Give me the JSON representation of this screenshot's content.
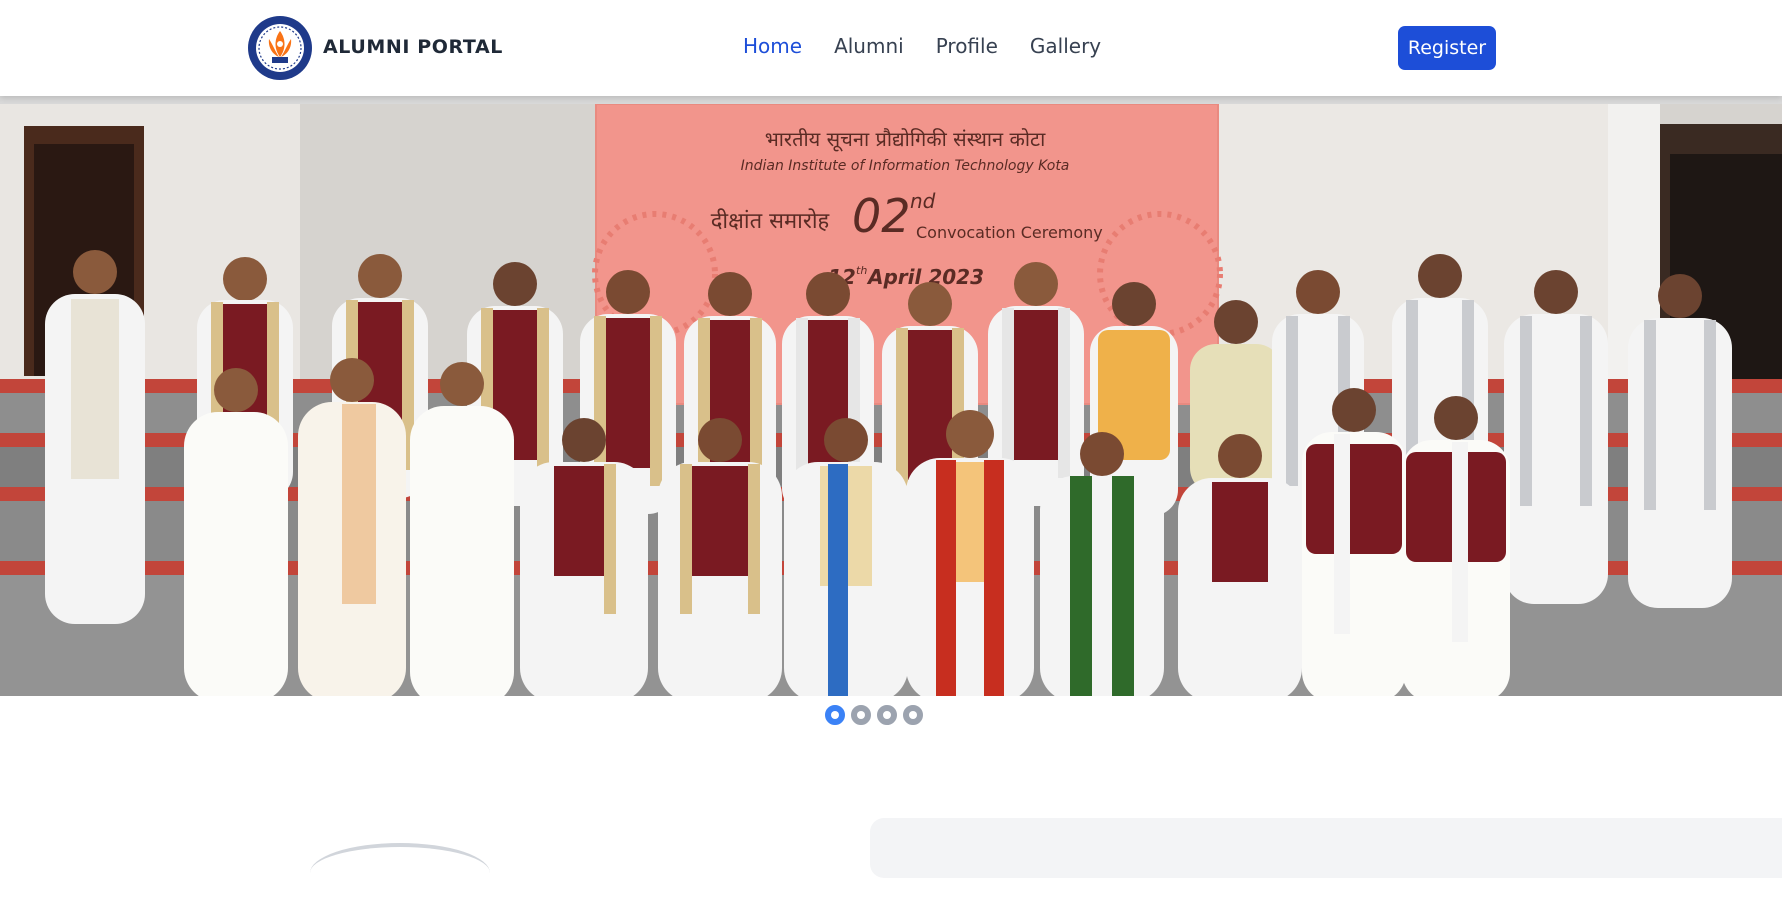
{
  "brand": {
    "name": "ALUMNI PORTAL",
    "logo_icon": "institute-logo-icon"
  },
  "nav": {
    "items": [
      {
        "label": "Home",
        "active": true
      },
      {
        "label": "Alumni",
        "active": false
      },
      {
        "label": "Profile",
        "active": false
      },
      {
        "label": "Gallery",
        "active": false
      }
    ],
    "register_label": "Register"
  },
  "hero": {
    "banner_hindi_title": "भारतीय सूचना प्रौद्योगिकी संस्थान कोटा",
    "banner_english_title": "Indian Institute of Information Technology Kota",
    "convocation_hindi": "दीक्षांत समारोह",
    "convocation_number": "02",
    "convocation_suffix": "nd",
    "convocation_label": "Convocation Ceremony",
    "date_day": "12",
    "date_suffix": "th",
    "date_rest": "April 2023"
  },
  "carousel": {
    "slide_count": 4,
    "active_index": 0
  },
  "colors": {
    "accent": "#1d4ed8",
    "nav_active": "#1d4ed8",
    "banner": "#f2958c",
    "dot_active": "#3b82f6",
    "dot_inactive": "#9ca3af"
  }
}
